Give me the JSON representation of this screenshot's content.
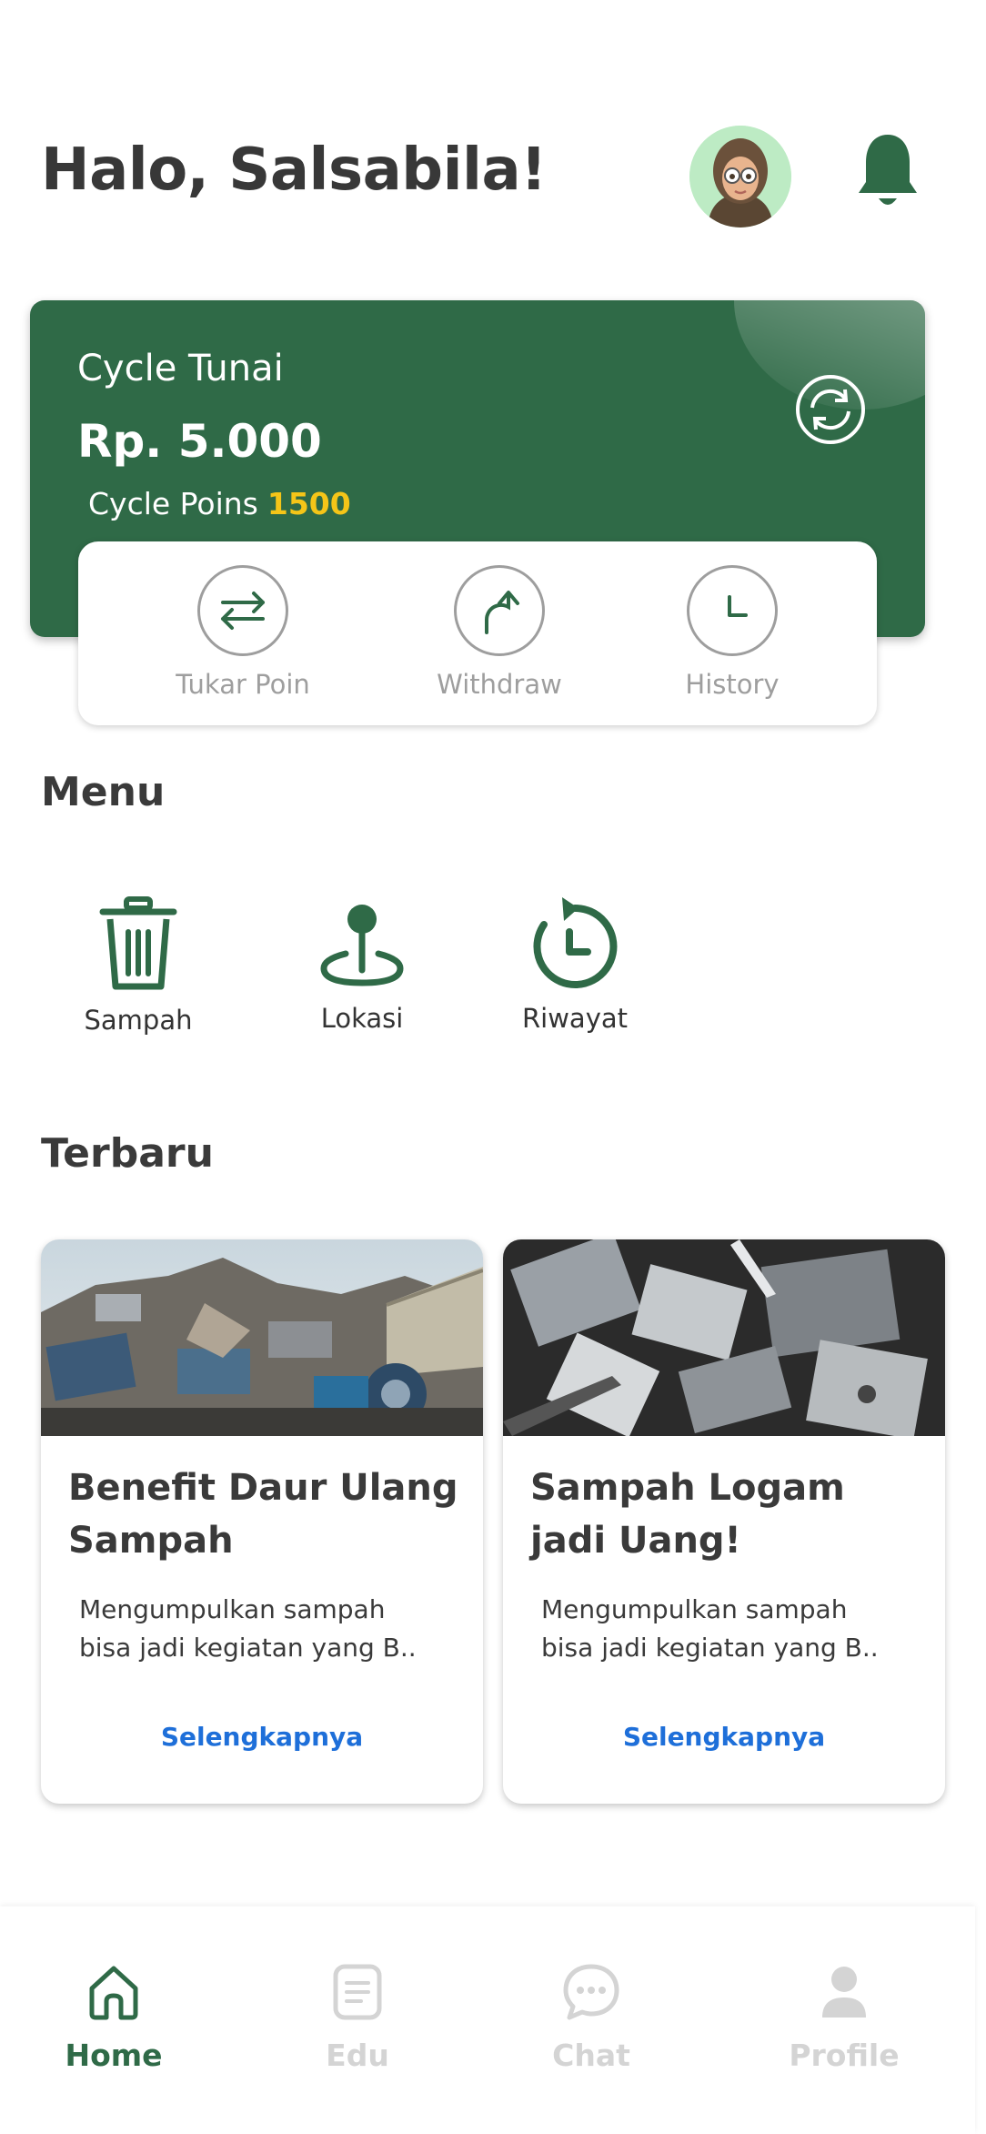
{
  "header": {
    "greeting": "Halo, Salsabila!"
  },
  "balance": {
    "title": "Cycle Tunai",
    "amount": "Rp. 5.000",
    "points_label": "Cycle Poins",
    "points_value": "1500"
  },
  "actions": [
    {
      "label": "Tukar Poin",
      "icon": "swap-arrows-icon"
    },
    {
      "label": "Withdraw",
      "icon": "withdraw-arrow-icon"
    },
    {
      "label": "History",
      "icon": "clock-icon"
    }
  ],
  "menu": {
    "title": "Menu",
    "items": [
      {
        "label": "Sampah",
        "icon": "trash-icon"
      },
      {
        "label": "Lokasi",
        "icon": "location-pin-icon"
      },
      {
        "label": "Riwayat",
        "icon": "history-icon"
      }
    ]
  },
  "latest": {
    "title": "Terbaru",
    "cards": [
      {
        "title": "Benefit Daur Ulang Sampah",
        "description": "Mengumpulkan sampah bisa jadi kegiatan yang B..",
        "link": "Selengkapnya"
      },
      {
        "title": "Sampah Logam jadi Uang!",
        "description": "Mengumpulkan sampah bisa jadi kegiatan yang B..",
        "link": "Selengkapnya"
      }
    ]
  },
  "nav": [
    {
      "label": "Home",
      "icon": "home-icon",
      "active": true
    },
    {
      "label": "Edu",
      "icon": "document-icon",
      "active": false
    },
    {
      "label": "Chat",
      "icon": "chat-bubble-icon",
      "active": false
    },
    {
      "label": "Profile",
      "icon": "person-icon",
      "active": false
    }
  ],
  "colors": {
    "primary": "#2f6a47",
    "points": "#f5c518",
    "link": "#1e6fd9",
    "inactive": "#d4d4d4"
  }
}
